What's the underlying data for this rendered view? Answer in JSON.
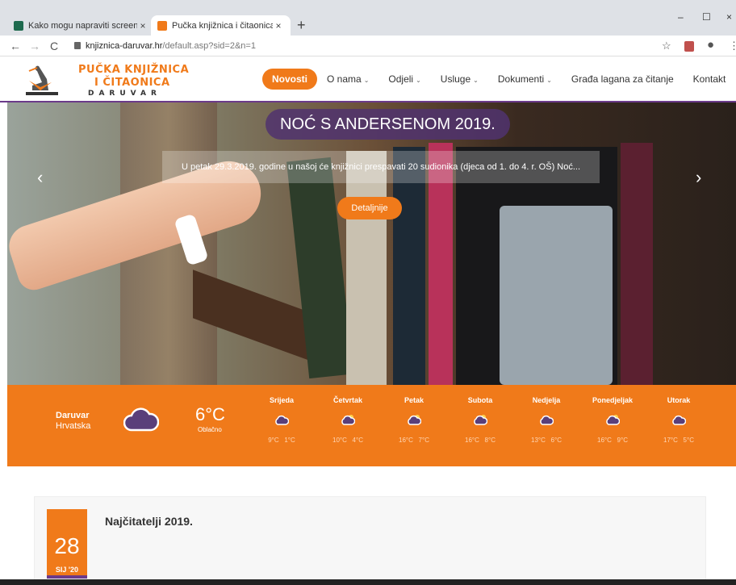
{
  "browser": {
    "tabs": [
      {
        "title": "Kako mogu napraviti screenshot",
        "active": false
      },
      {
        "title": "Pučka knjižnica i čitaonica Daruv",
        "active": true
      }
    ],
    "new_tab": "+",
    "tab_close": "×",
    "url_host": "knjiznica-daruvar.hr",
    "url_path": "/default.asp?sid=2&n=1",
    "nav_back": "←",
    "nav_forward": "→",
    "nav_reload": "C",
    "window_min": "–",
    "window_max": "☐",
    "window_close": "×"
  },
  "site": {
    "logo_line1": "PUČKA KNJIŽNICA",
    "logo_line2": "I ČITAONICA",
    "logo_line3": "DARUVAR",
    "nav": [
      {
        "label": "Novosti",
        "active": true,
        "dropdown": false
      },
      {
        "label": "O nama",
        "active": false,
        "dropdown": true
      },
      {
        "label": "Odjeli",
        "active": false,
        "dropdown": true
      },
      {
        "label": "Usluge",
        "active": false,
        "dropdown": true
      },
      {
        "label": "Dokumenti",
        "active": false,
        "dropdown": true
      },
      {
        "label": "Građa lagana za čitanje",
        "active": false,
        "dropdown": false
      },
      {
        "label": "Kontakt",
        "active": false,
        "dropdown": false
      }
    ]
  },
  "hero": {
    "title": "NOĆ S ANDERSENOM 2019.",
    "text": "U petak 29.3.2019. godine u našoj će knjižnici prespavati 20 sudionika (djeca od 1. do 4. r. OŠ) Noć...",
    "button": "Detaljnije",
    "prev": "‹",
    "next": "›"
  },
  "weather": {
    "city": "Daruvar",
    "country": "Hrvatska",
    "temp": "6°C",
    "desc": "Oblačno",
    "days": [
      {
        "name": "Srijeda",
        "hi": "9°C",
        "lo": "1°C",
        "icon": "cloud-icon"
      },
      {
        "name": "Četvrtak",
        "hi": "10°C",
        "lo": "4°C",
        "icon": "partly-sunny-icon"
      },
      {
        "name": "Petak",
        "hi": "16°C",
        "lo": "7°C",
        "icon": "partly-sunny-icon"
      },
      {
        "name": "Subota",
        "hi": "16°C",
        "lo": "8°C",
        "icon": "partly-sunny-icon"
      },
      {
        "name": "Nedjelja",
        "hi": "13°C",
        "lo": "6°C",
        "icon": "cloud-icon"
      },
      {
        "name": "Ponedjeljak",
        "hi": "16°C",
        "lo": "9°C",
        "icon": "partly-sunny-icon"
      },
      {
        "name": "Utorak",
        "hi": "17°C",
        "lo": "5°C",
        "icon": "cloud-icon"
      }
    ]
  },
  "news": {
    "day": "28",
    "month": "SIJ '20",
    "title": "Najčitatelji 2019."
  },
  "colors": {
    "accent": "#f07a1a",
    "purple": "#6b3a8a"
  }
}
